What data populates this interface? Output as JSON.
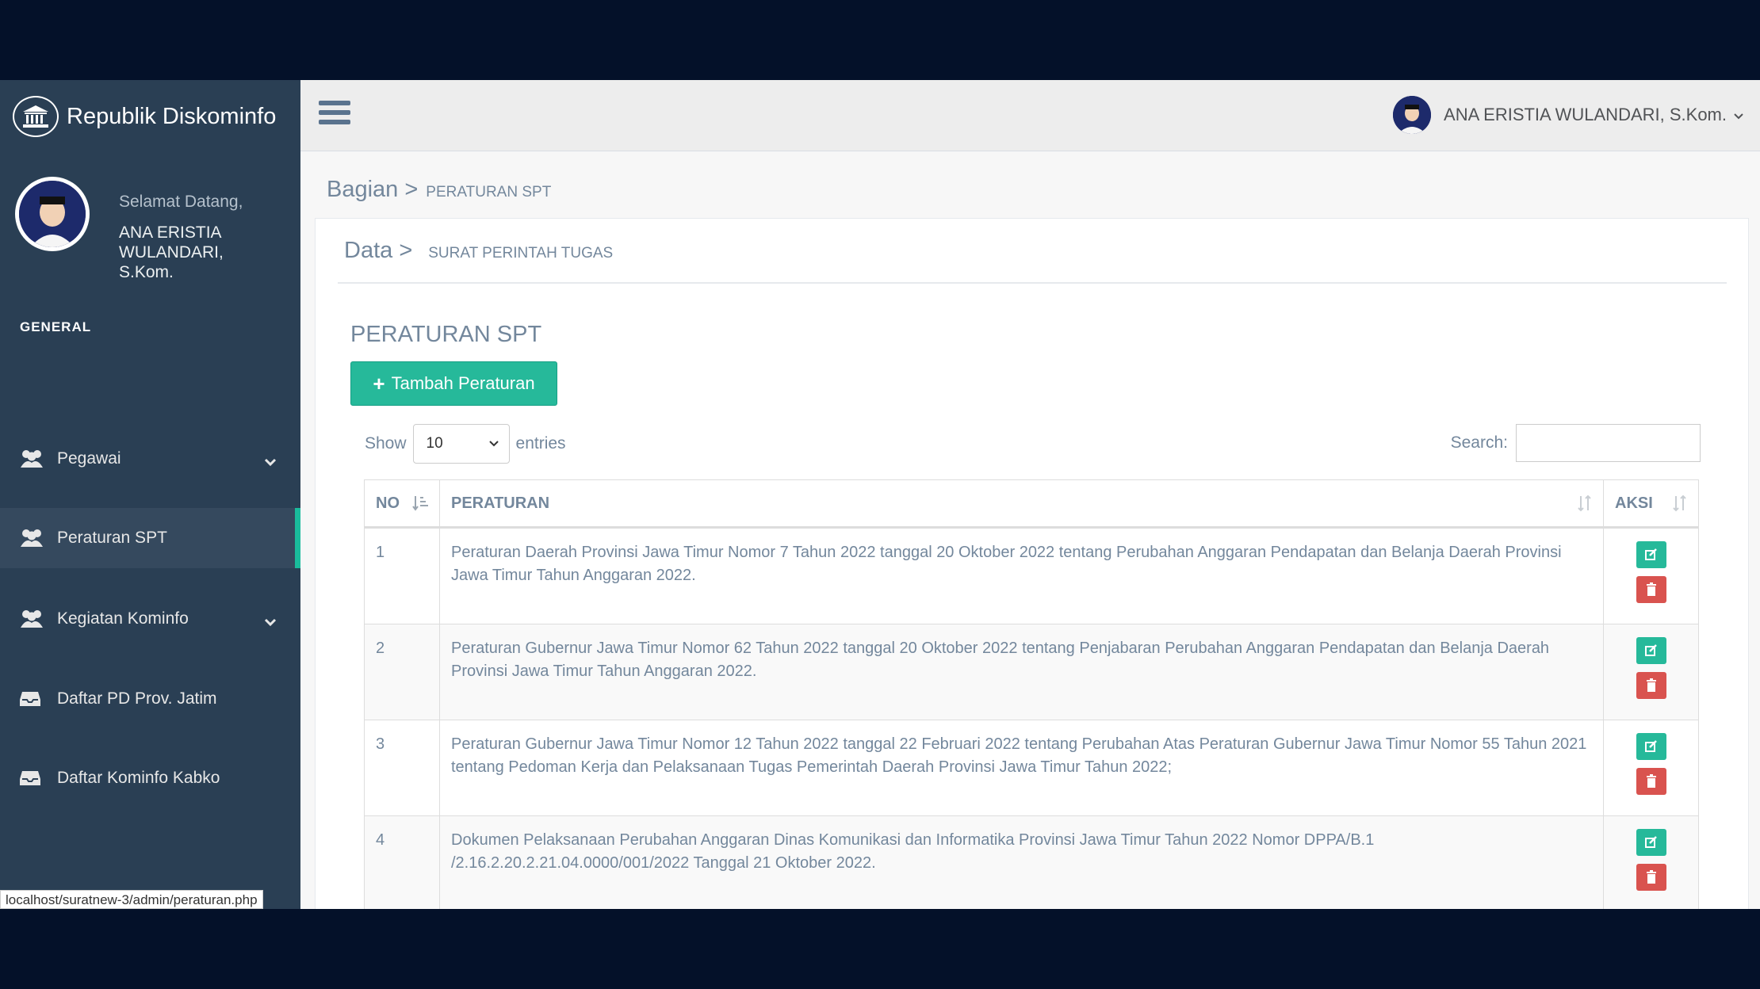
{
  "brand": {
    "title": "Republik Diskominfo",
    "icon": "institution-icon"
  },
  "profile": {
    "welcome": "Selamat Datang,",
    "name": "ANA ERISTIA WULANDARI, S.Kom."
  },
  "sidebar": {
    "section": "GENERAL",
    "items": [
      {
        "label": "Pegawai",
        "icon": "users-icon"
      },
      {
        "label": "Peraturan SPT",
        "icon": "users-icon"
      },
      {
        "label": "Kegiatan Kominfo",
        "icon": "users-icon"
      },
      {
        "label": "Daftar PD Prov. Jatim",
        "icon": "inbox-icon"
      },
      {
        "label": "Daftar Kominfo Kabko",
        "icon": "inbox-icon"
      }
    ]
  },
  "topnav": {
    "user_name": "ANA ERISTIA WULANDARI, S.Kom."
  },
  "page": {
    "title": "Bagian >",
    "subtitle": "PERATURAN SPT"
  },
  "panel": {
    "title": "Data >",
    "subtitle": "SURAT PERINTAH TUGAS",
    "section_title": "PERATURAN SPT",
    "add_button": "Tambah Peraturan"
  },
  "table_controls": {
    "show": "Show",
    "length": "10",
    "entries": "entries",
    "search_label": "Search:",
    "search_value": ""
  },
  "table": {
    "headers": [
      "NO",
      "PERATURAN",
      "AKSI"
    ],
    "rows": [
      {
        "no": "1",
        "text": "Peraturan Daerah Provinsi Jawa Timur Nomor 7 Tahun 2022 tanggal 20 Oktober 2022 tentang Perubahan Anggaran Pendapatan dan Belanja Daerah Provinsi Jawa Timur Tahun Anggaran 2022."
      },
      {
        "no": "2",
        "text": "Peraturan Gubernur Jawa Timur Nomor 62 Tahun 2022 tanggal 20 Oktober 2022 tentang Penjabaran Perubahan Anggaran Pendapatan dan Belanja Daerah Provinsi Jawa Timur Tahun Anggaran 2022."
      },
      {
        "no": "3",
        "text": "Peraturan Gubernur Jawa Timur Nomor 12 Tahun 2022 tanggal 22 Februari 2022 tentang Perubahan Atas Peraturan Gubernur Jawa Timur Nomor 55 Tahun 2021 tentang Pedoman Kerja dan Pelaksanaan Tugas Pemerintah Daerah Provinsi Jawa Timur Tahun 2022;"
      },
      {
        "no": "4",
        "text": "Dokumen Pelaksanaan Perubahan Anggaran Dinas Komunikasi dan Informatika Provinsi Jawa Timur Tahun 2022 Nomor DPPA/B.1 /2.16.2.20.2.21.04.0000/001/2022 Tanggal 21 Oktober 2022."
      }
    ]
  },
  "status_bar": "localhost/suratnew-3/admin/peraturan.php",
  "colors": {
    "sidebar": "#2a3f54",
    "accent": "#1abb9c",
    "success": "#26b99a",
    "danger": "#d9534f",
    "text": "#73879c"
  }
}
